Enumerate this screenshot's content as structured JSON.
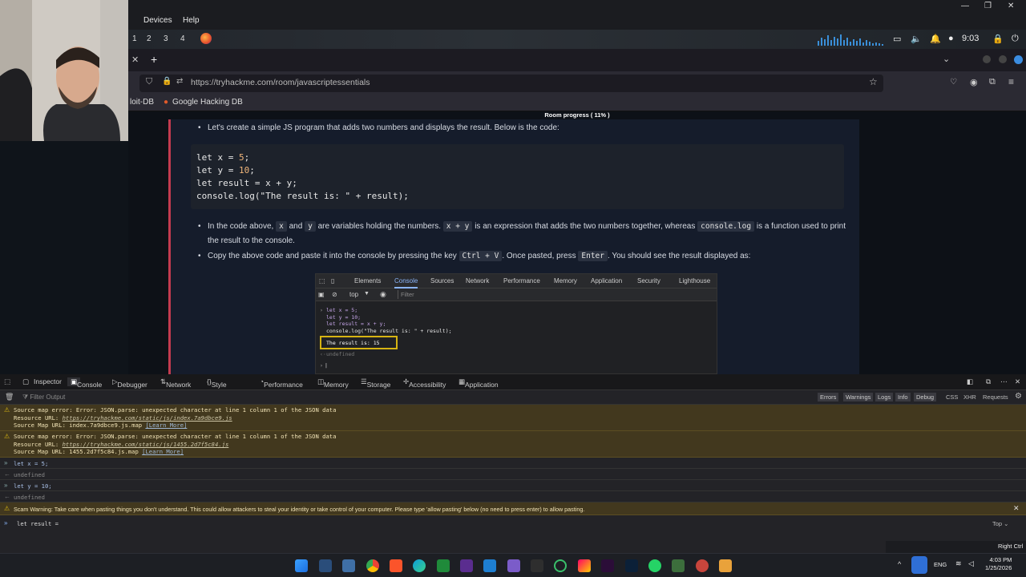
{
  "os": {
    "menu": [
      "Devices",
      "Help"
    ],
    "workspaces": [
      "1",
      "2",
      "3",
      "4"
    ],
    "time": "9:03",
    "taskbar_lang": "ENG",
    "taskbar_time": "4:03 PM",
    "taskbar_date": "1/25/2026",
    "right_ctrl": "Right Ctrl"
  },
  "browser": {
    "url": "https://tryhackme.com/room/javascriptessentials",
    "bookmarks": [
      "loit-DB",
      "Google Hacking DB"
    ],
    "new_tab": "+"
  },
  "page": {
    "progress": "Room progress ( 11% )",
    "intro": "Let's create a simple JS program that adds two numbers and displays the result. Below is the code:",
    "code_lines": {
      "l1_a": "let x = ",
      "l1_n": "5",
      "l1_b": ";",
      "l2_a": "let y = ",
      "l2_n": "10",
      "l2_b": ";",
      "l3": "let result = x + y;",
      "l4_a": "console.log(",
      "l4_s": "\"The result is: \"",
      "l4_b": " + result);"
    },
    "bullet2": {
      "p1": "In the code above,",
      "c1": "x",
      "p2": "and",
      "c2": "y",
      "p3": "are variables holding the numbers.",
      "c3": "x + y",
      "p4": "is an expression that adds the two numbers together, whereas",
      "c4": "console.log",
      "p5": "is a function used to print",
      "p6": "the result to the console."
    },
    "bullet3": {
      "p1": "Copy the above code and paste it into the console by pressing the key",
      "c1": "Ctrl + V",
      "p2": ". Once pasted, press",
      "c2": "Enter",
      "p3": ". You should see the result displayed as:"
    },
    "chrome_dt": {
      "tabs": [
        "Elements",
        "Console",
        "Sources",
        "Network",
        "Performance",
        "Memory",
        "Application",
        "Security",
        "Lighthouse"
      ],
      "context": "top",
      "filter": "Filter",
      "code": [
        "let x = 5;",
        "let y = 10;",
        "let result = x + y;",
        "console.log(\"The result is: \" + result);"
      ],
      "result": "The result is: 15",
      "undef": "undefined",
      "caret": "|"
    }
  },
  "devtools": {
    "tabs": [
      "Inspector",
      "Console",
      "Debugger",
      "Network",
      "Style Editor",
      "Performance",
      "Memory",
      "Storage",
      "Accessibility",
      "Application"
    ],
    "filter_placeholder": "Filter Output",
    "levels": [
      "Errors",
      "Warnings",
      "Logs",
      "Info",
      "Debug"
    ],
    "types": [
      "CSS",
      "XHR",
      "Requests"
    ],
    "warn1": {
      "l1": "Source map error: Error: JSON.parse: unexpected character at line 1 column 1 of the JSON data",
      "l2a": "Resource URL: ",
      "l2b": "https://tryhackme.com/static/js/index.7a9dbce9.js",
      "l3a": "Source Map URL: index.7a9dbce9.js.map ",
      "l3b": "[Learn More]"
    },
    "warn2": {
      "l1": "Source map error: Error: JSON.parse: unexpected character at line 1 column 1 of the JSON data",
      "l2a": "Resource URL: ",
      "l2b": "https://tryhackme.com/static/js/1455.2d7f5c84.js",
      "l3a": "Source Map URL: 1455.2d7f5c84.js.map ",
      "l3b": "[Learn More]"
    },
    "log": [
      "let x = 5;",
      "undefined",
      "let y = 10;",
      "undefined"
    ],
    "scam_warning": "Scam Warning: Take care when pasting things you don't understand. This could allow attackers to steal your identity or take control of your computer. Please type 'allow pasting' below (no need to press enter) to allow pasting.",
    "input": "let result =",
    "top": "Top"
  }
}
